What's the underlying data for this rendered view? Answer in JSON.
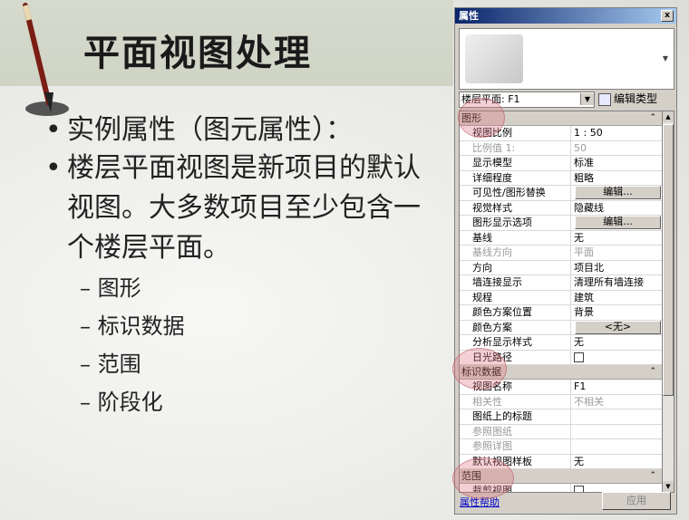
{
  "slide": {
    "title": "平面视图处理",
    "bullet1": "实例属性（图元属性）：",
    "bullet2": "楼层平面视图是新项目的默认视图。大多数项目至少包含一个楼层平面。",
    "bullet_marker": "•",
    "subitems": [
      "– 图形",
      "– 标识数据",
      "– 范围",
      "– 阶段化"
    ]
  },
  "palette": {
    "title": "属性",
    "close": "x",
    "type_selector": "楼层平面: F1",
    "edit_type": "编辑类型",
    "groups": {
      "graphics": "图形",
      "identity": "标识数据",
      "extents": "范围"
    },
    "graphics_rows": [
      {
        "k": "视图比例",
        "v": "1 : 50"
      },
      {
        "k": "比例值 1:",
        "v": "50",
        "disabled": true
      },
      {
        "k": "显示模型",
        "v": "标准"
      },
      {
        "k": "详细程度",
        "v": "粗略"
      },
      {
        "k": "可见性/图形替换",
        "v": "编辑...",
        "button": true
      },
      {
        "k": "视觉样式",
        "v": "隐藏线"
      },
      {
        "k": "图形显示选项",
        "v": "编辑...",
        "button": true
      },
      {
        "k": "基线",
        "v": "无"
      },
      {
        "k": "基线方向",
        "v": "平面",
        "disabled": true
      },
      {
        "k": "方向",
        "v": "项目北"
      },
      {
        "k": "墙连接显示",
        "v": "清理所有墙连接"
      },
      {
        "k": "规程",
        "v": "建筑"
      },
      {
        "k": "颜色方案位置",
        "v": "背景"
      },
      {
        "k": "颜色方案",
        "v": "<无>",
        "button": true
      },
      {
        "k": "分析显示样式",
        "v": "无"
      },
      {
        "k": "日光路径",
        "v": "",
        "checkbox": true
      }
    ],
    "identity_rows": [
      {
        "k": "视图名称",
        "v": "F1"
      },
      {
        "k": "相关性",
        "v": "不相关",
        "disabled": true
      },
      {
        "k": "图纸上的标题",
        "v": ""
      },
      {
        "k": "参照图纸",
        "v": "",
        "disabled": true
      },
      {
        "k": "参照详图",
        "v": "",
        "disabled": true
      },
      {
        "k": "默认视图样板",
        "v": "无"
      }
    ],
    "extents_rows": [
      {
        "k": "裁剪视图",
        "v": "",
        "checkbox": true
      }
    ],
    "help_link": "属性帮助",
    "apply": "应用"
  }
}
